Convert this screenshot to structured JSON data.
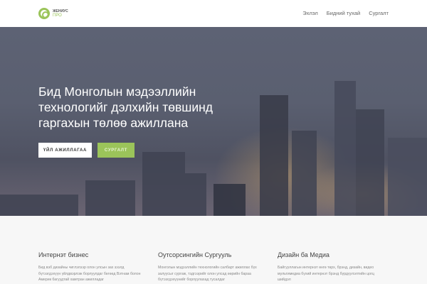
{
  "nav": {
    "logo_line1": "ЖЕНИУС",
    "logo_line2": "ПРО",
    "items": [
      "Эхлэл",
      "Бидний тухай",
      "Сургалт"
    ]
  },
  "hero": {
    "title": "Бид Монголын мэдээллийн технологийг дэлхийн төвшинд гаргахын төлөө ажиллана",
    "primary_button": "ҮЙЛ АЖИЛЛАГАА",
    "secondary_button": "СУРГАЛТ"
  },
  "features": [
    {
      "title": "Интернэт бизнес",
      "text": "Бид вэб дизайны чиглэлээр олон улсын зах зээлд бүтээгдэхүүн үйлдвэрлэж борлуулдаг бөгөөд Вэтнам болон Америк багуудтай хамтран ажилладаг"
    },
    {
      "title": "Оутсорсингийн Сургууль",
      "text": "Монголын мэдээллийн технологийн салбарт ажиллах бүх залуусыг сургаж, тэдгээрийг олон улсад өөрийн бараа бүтээгдэхүүнийг борлуулахад тусалдаг"
    },
    {
      "title": "Дизайн ба Медиа",
      "text": "Байгууллагын интернэт өнгө төрх, брэнд, дизайн, видео мультимедиа бүхий интернэт брэнд бүрдүүлэлтийн цогц шийдэл"
    }
  ]
}
